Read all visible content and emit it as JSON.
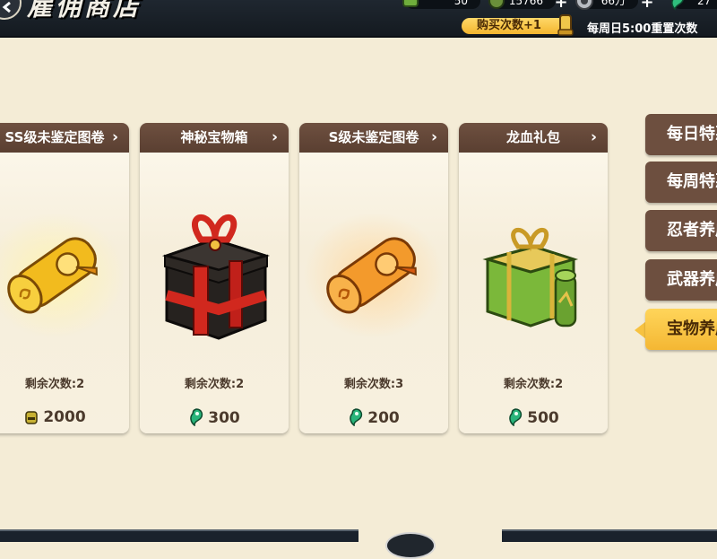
{
  "header": {
    "title": "雇佣商店",
    "resources": [
      {
        "name": "scroll",
        "value": "50"
      },
      {
        "name": "gold",
        "value": "15766"
      },
      {
        "name": "silver",
        "value": "66万"
      },
      {
        "name": "jade",
        "value": "27"
      }
    ],
    "buy_badge": "购买次数+1",
    "reset_text": "每周日5:00重置次数"
  },
  "items": [
    {
      "name": "SS级未鉴定图卷",
      "remaining": "剩余次数:2",
      "price": "2000",
      "currency": "gold-helmet-icon",
      "art": "golden-scroll"
    },
    {
      "name": "神秘宝物箱",
      "remaining": "剩余次数:2",
      "price": "300",
      "currency": "jade-magatama-icon",
      "art": "black-red-giftbox"
    },
    {
      "name": "S级未鉴定图卷",
      "remaining": "剩余次数:3",
      "price": "200",
      "currency": "jade-magatama-icon",
      "art": "orange-scroll"
    },
    {
      "name": "龙血礼包",
      "remaining": "剩余次数:2",
      "price": "500",
      "currency": "jade-magatama-icon",
      "art": "green-gift-pack"
    }
  ],
  "tabs": [
    {
      "label": "每日特惠",
      "active": false
    },
    {
      "label": "每周特惠",
      "active": false
    },
    {
      "label": "忍者养成",
      "active": false
    },
    {
      "label": "武器养成",
      "active": false
    },
    {
      "label": "宝物养成",
      "active": true
    }
  ],
  "colors": {
    "background": "#f4ecd6",
    "card_header": "#5f4435",
    "tab_active": "#f6be3c",
    "jade": "#28b47a",
    "topbar": "#161c22"
  }
}
